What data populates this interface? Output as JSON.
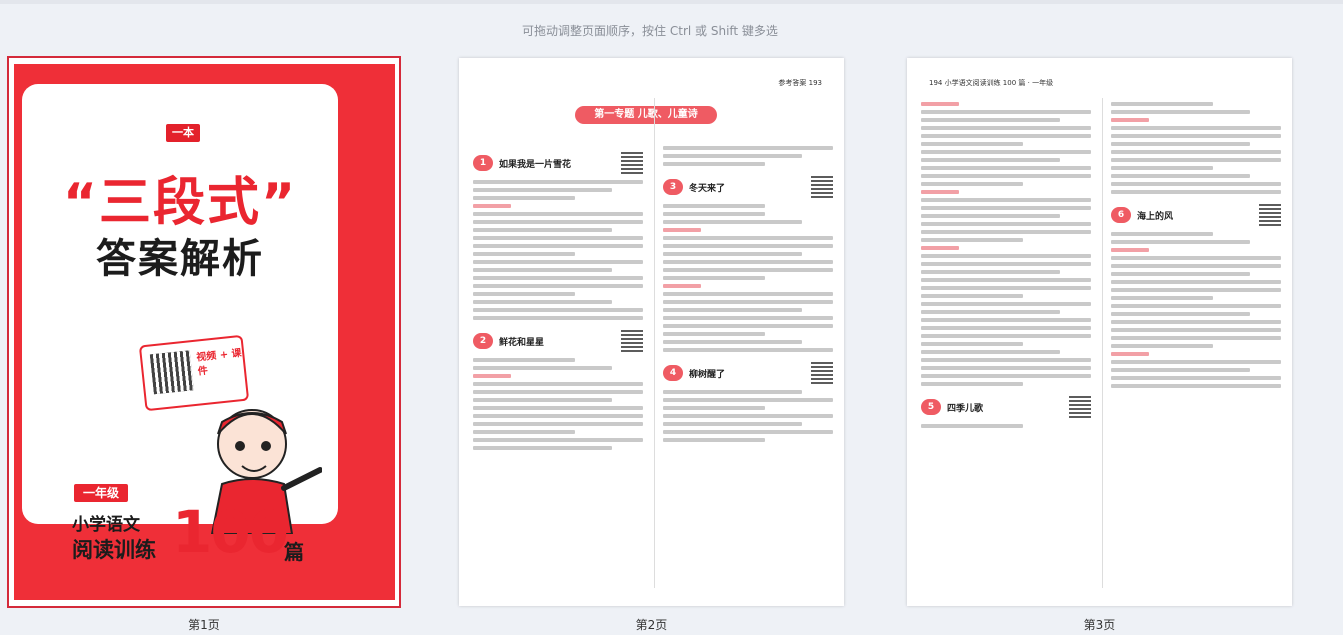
{
  "hint": "可拖动调整页面顺序，按住 Ctrl 或 Shift 键多选",
  "pages": [
    {
      "label": "第1页"
    },
    {
      "label": "第2页"
    },
    {
      "label": "第3页"
    }
  ],
  "cover": {
    "logo": "一本",
    "title_main": "“三段式”",
    "title_sub": "答案解析",
    "sign_text": "视频 + 课件",
    "grade": "一年级",
    "series_line1": "小学语文",
    "series_line2": "阅读训练",
    "series_num": "100",
    "series_unit": "篇"
  },
  "page2": {
    "header": "参考答案 193",
    "banner": "第一专题  儿歌、儿童诗",
    "sections": [
      {
        "num": "1",
        "title": "如果我是一片雪花"
      },
      {
        "num": "2",
        "title": "鲜花和星星"
      },
      {
        "num": "3",
        "title": "冬天来了"
      },
      {
        "num": "4",
        "title": "柳树醒了"
      }
    ]
  },
  "page3": {
    "header": "194 小学语文阅读训练 100 篇 · 一年级",
    "sections": [
      {
        "num": "6",
        "title": "海上的风"
      },
      {
        "num": "5",
        "title": "四季儿歌"
      }
    ]
  },
  "colors": {
    "accent": "#ea2630",
    "selected_outline": "#d42a3a",
    "section_badge": "#ef5b63"
  }
}
